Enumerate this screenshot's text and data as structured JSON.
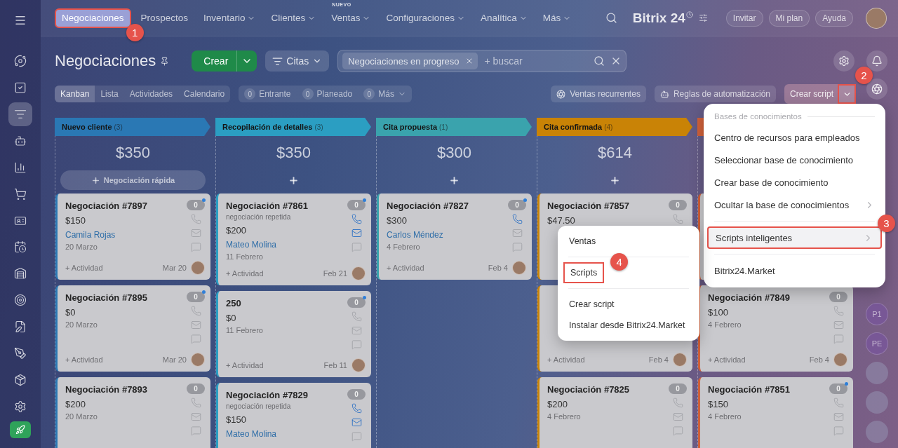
{
  "sidebar": {
    "items": [
      {
        "selected": false
      },
      {
        "selected": false
      },
      {
        "selected": true
      },
      {
        "selected": false
      },
      {
        "selected": false
      },
      {
        "selected": false
      },
      {
        "selected": false
      },
      {
        "selected": false
      },
      {
        "selected": false
      },
      {
        "selected": false
      },
      {
        "selected": false
      },
      {
        "selected": false
      },
      {
        "selected": false
      },
      {
        "selected": false
      }
    ]
  },
  "topnav": {
    "items": [
      {
        "label": "Negociaciones",
        "selected": true,
        "has_menu": false,
        "callout": "1"
      },
      {
        "label": "Prospectos",
        "selected": false,
        "has_menu": false
      },
      {
        "label": "Inventario",
        "selected": false,
        "has_menu": true
      },
      {
        "label": "Clientes",
        "selected": false,
        "has_menu": true
      },
      {
        "label": "Ventas",
        "selected": false,
        "has_menu": true,
        "badge": "NUEVO"
      },
      {
        "label": "Configuraciones",
        "selected": false,
        "has_menu": true
      },
      {
        "label": "Analítica",
        "selected": false,
        "has_menu": true
      },
      {
        "label": "Más",
        "selected": false,
        "has_menu": true
      }
    ]
  },
  "header_right": {
    "logo": "Bitrix 24",
    "buttons": [
      "Invitar",
      "Mi plan",
      "Ayuda"
    ]
  },
  "toolbar": {
    "title": "Negociaciones",
    "create_button": "Crear",
    "category_button": "Citas",
    "filter_chip": "Negociaciones en progreso",
    "search_placeholder": "+ buscar"
  },
  "views": [
    {
      "label": "Kanban",
      "selected": true
    },
    {
      "label": "Lista",
      "selected": false
    },
    {
      "label": "Actividades",
      "selected": false
    },
    {
      "label": "Calendario",
      "selected": false
    }
  ],
  "counters": [
    {
      "count": "0",
      "label": "Entrante",
      "has_menu": false
    },
    {
      "count": "0",
      "label": "Planeado",
      "has_menu": false
    },
    {
      "count": "0",
      "label": "Más",
      "has_menu": true
    }
  ],
  "actions": [
    {
      "label": "Ventas recurrentes",
      "kind": "recurring"
    },
    {
      "label": "Reglas de automatización",
      "kind": "robot"
    }
  ],
  "script_button": {
    "label": "Crear script",
    "callout": "2"
  },
  "columns": [
    {
      "title": "Nuevo cliente",
      "count": "(3)",
      "color": "#2a78b4",
      "total": "$350",
      "quick_add": "Negociación rápida",
      "cards": [
        {
          "kind": "deal",
          "title": "Negociación #7897",
          "amount": "$150",
          "client": "Camila Rojas",
          "date": "20 Marzo",
          "count": "0",
          "unread": true,
          "channels": {
            "phone": false,
            "mail": false
          },
          "activity": "+ Actividad",
          "footer_date": "Mar 20"
        },
        {
          "kind": "deal",
          "title": "Negociación #7895",
          "amount": "$0",
          "date": "20 Marzo",
          "count": "0",
          "unread": true,
          "channels": {
            "phone": false,
            "mail": false
          },
          "activity": "+ Actividad",
          "footer_date": "Mar 20"
        },
        {
          "kind": "deal",
          "title": "Negociación #7893",
          "amount": "$200",
          "date": "20 Marzo",
          "count": "0",
          "unread": false,
          "channels": {
            "phone": false,
            "mail": false
          }
        }
      ]
    },
    {
      "title": "Recopilación de detalles",
      "count": "(3)",
      "color": "#2b9ec2",
      "total": "$350",
      "cards": [
        {
          "kind": "deal",
          "title": "Negociación #7861",
          "subtitle": "negociación repetida",
          "amount": "$200",
          "client": "Mateo Molina",
          "date": "11 Febrero",
          "count": "0",
          "unread": true,
          "channels": {
            "phone": true,
            "mail": true
          },
          "activity": "+ Actividad",
          "footer_date": "Feb 21"
        },
        {
          "kind": "deal",
          "title": "250",
          "amount": "$0",
          "date": "11 Febrero",
          "count": "0",
          "unread": true,
          "channels": {
            "phone": false,
            "mail": false
          },
          "activity": "+ Actividad",
          "footer_date": "Feb 11"
        },
        {
          "kind": "deal",
          "title": "Negociación #7829",
          "subtitle": "negociación repetida",
          "amount": "$150",
          "client": "Mateo Molina",
          "count": "0",
          "unread": false,
          "channels": {
            "phone": true,
            "mail": true
          }
        }
      ]
    },
    {
      "title": "Cita propuesta",
      "count": "(1)",
      "color": "#3aa3ad",
      "total": "$300",
      "cards": [
        {
          "kind": "deal",
          "title": "Negociación #7827",
          "amount": "$300",
          "client": "Carlos Méndez",
          "date": "4 Febrero",
          "count": "0",
          "unread": true,
          "channels": {
            "phone": true,
            "mail": false
          },
          "activity": "+ Actividad",
          "footer_date": "Feb 4"
        }
      ]
    },
    {
      "title": "Cita confirmada",
      "count": "(4)",
      "color": "#c98306",
      "total": "$614",
      "cards": [
        {
          "kind": "deal",
          "title": "Negociación #7857",
          "amount": "$47.50",
          "count": "0",
          "unread": false,
          "channels": {
            "phone": false
          }
        },
        {
          "kind": "deal",
          "activity": "+ Actividad",
          "footer_date": "Feb 4"
        },
        {
          "kind": "deal",
          "title": "Negociación #7825",
          "amount": "$200",
          "date": "4 Febrero",
          "count": "0",
          "unread": false,
          "channels": {
            "phone": false,
            "mail": false
          }
        }
      ]
    },
    {
      "color": "#d0613a",
      "cards": [
        {
          "kind": "covered"
        },
        {
          "kind": "deal",
          "title": "Negociación #7849",
          "amount": "$100",
          "date": "4 Febrero",
          "count": "0",
          "unread": false,
          "channels": {
            "phone": false,
            "mail": false
          },
          "activity": "+ Actividad",
          "footer_date": "Feb 4"
        },
        {
          "kind": "deal",
          "title": "Negociación #7851",
          "amount": "$150",
          "date": "4 Febrero",
          "count": "0",
          "unread": true,
          "channels": {
            "phone": false,
            "mail": false
          }
        }
      ]
    }
  ],
  "right_rail": [
    {
      "kind": "initials",
      "text": "P1"
    },
    {
      "kind": "initials",
      "text": "PE"
    },
    {
      "kind": "photo"
    },
    {
      "kind": "photo"
    },
    {
      "kind": "photo"
    }
  ],
  "dropdown": {
    "section": "Bases de conocimientos",
    "items": [
      {
        "kind": "item",
        "label": "Centro de recursos para empleados",
        "submenu": false,
        "highlighted": false
      },
      {
        "kind": "item",
        "label": "Seleccionar base de conocimiento",
        "submenu": false,
        "highlighted": false
      },
      {
        "kind": "item",
        "label": "Crear base de conocimiento",
        "submenu": false,
        "highlighted": false
      },
      {
        "kind": "item",
        "label": "Ocultar la base de conocimientos",
        "submenu": true,
        "highlighted": false
      },
      {
        "kind": "divider"
      },
      {
        "kind": "item",
        "label": "Scripts inteligentes",
        "submenu": true,
        "highlighted": true,
        "callout": "3"
      },
      {
        "kind": "divider"
      },
      {
        "kind": "item",
        "label": "Bitrix24.Market",
        "submenu": false,
        "highlighted": false
      }
    ]
  },
  "submenu": {
    "items": [
      {
        "kind": "item",
        "label": "Ventas"
      },
      {
        "kind": "divider"
      },
      {
        "kind": "item",
        "label": "Scripts",
        "callout": "4"
      },
      {
        "kind": "divider"
      },
      {
        "kind": "item",
        "label": "Crear script"
      },
      {
        "kind": "item",
        "label": "Instalar desde Bitrix24.Market"
      }
    ]
  }
}
